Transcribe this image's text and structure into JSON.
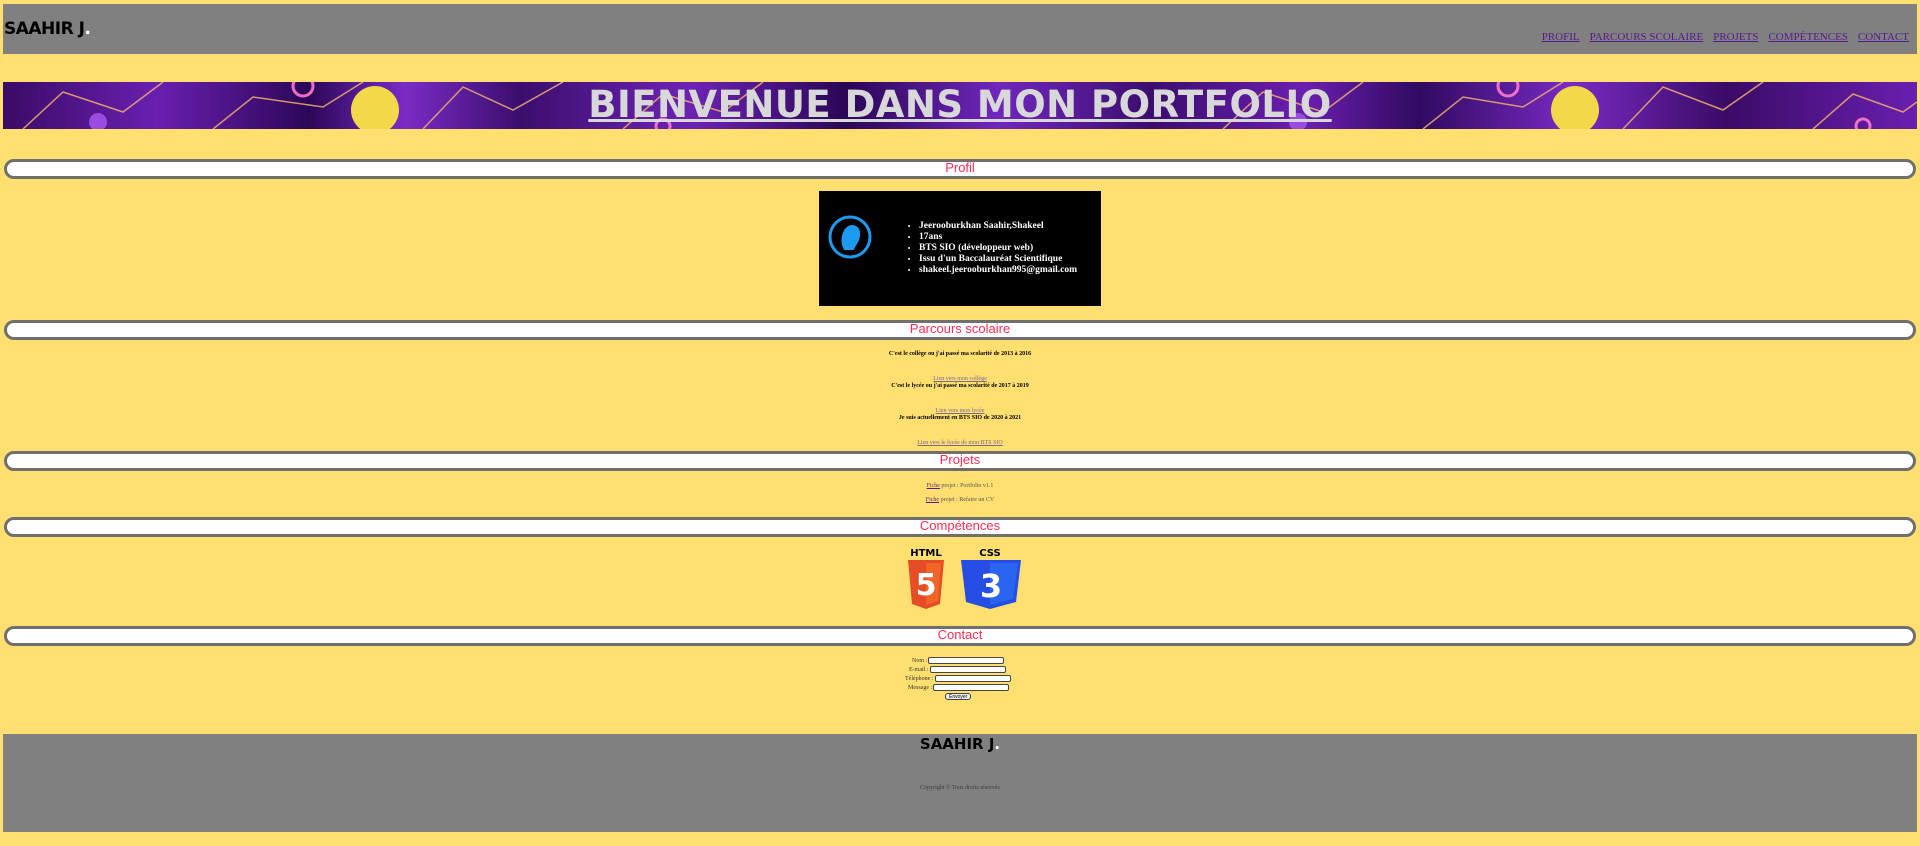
{
  "header": {
    "logo": "SAAHIR J",
    "logo_dot": ".",
    "nav": [
      "PROFIL",
      "PARCOURS SCOLAIRE",
      "PROJETS",
      "COMPÉTENCES",
      "CONTACT"
    ]
  },
  "banner": {
    "title": "BIENVENUE DANS MON PORTFOLIO"
  },
  "sections": {
    "profil": "Profil",
    "parcours": "Parcours scolaire",
    "projets": "Projets",
    "competences": "Compétences",
    "contact": "Contact"
  },
  "profile": {
    "items": [
      "Jeerooburkhan Saahir,Shakeel",
      "17ans",
      "BTS SIO (développeur web)",
      "Issu d'un Baccalauréat Scientifique",
      "shakeel.jeerooburkhan995@gmail.com"
    ]
  },
  "parcours": {
    "college_text": "C'est le collège ou j'ai passé ma scolarité de 2013 à 2016",
    "college_link": "Lien vers mon collège",
    "lycee_text": "C'est le lycée ou j'ai passé ma scolarité de 2017 à 2019",
    "lycee_link": "Lien vers mon lycée",
    "bts_text": "Je suis actuellement en BTS SIO de 2020 à 2021",
    "bts_link": "Lien vers le lycée de mon BTS SIO"
  },
  "projets": {
    "items": [
      {
        "kw": "Fiche",
        "rest": "projet : Portfolio v1.1"
      },
      {
        "kw": "Fiche",
        "rest": "projet : Refaire un CV"
      }
    ]
  },
  "skills": {
    "html_label": "HTML",
    "html_num": "5",
    "css_label": "CSS",
    "css_num": "3"
  },
  "contact": {
    "name_label": "Nom :",
    "email_label": "E-mail :",
    "phone_label": "Téléphone :",
    "message_label": "Message :",
    "submit": "Envoyer"
  },
  "footer": {
    "logo": "SAAHIR J",
    "logo_dot": ".",
    "copyright": "Copyright © Tous droits réservés"
  },
  "colors": {
    "page_bg": "#ffdf6f",
    "header_bg": "#808080",
    "section_title": "#ff2d55",
    "nav_link": "#551a8b",
    "html_orange": "#e44d26",
    "css_blue": "#264de4"
  }
}
